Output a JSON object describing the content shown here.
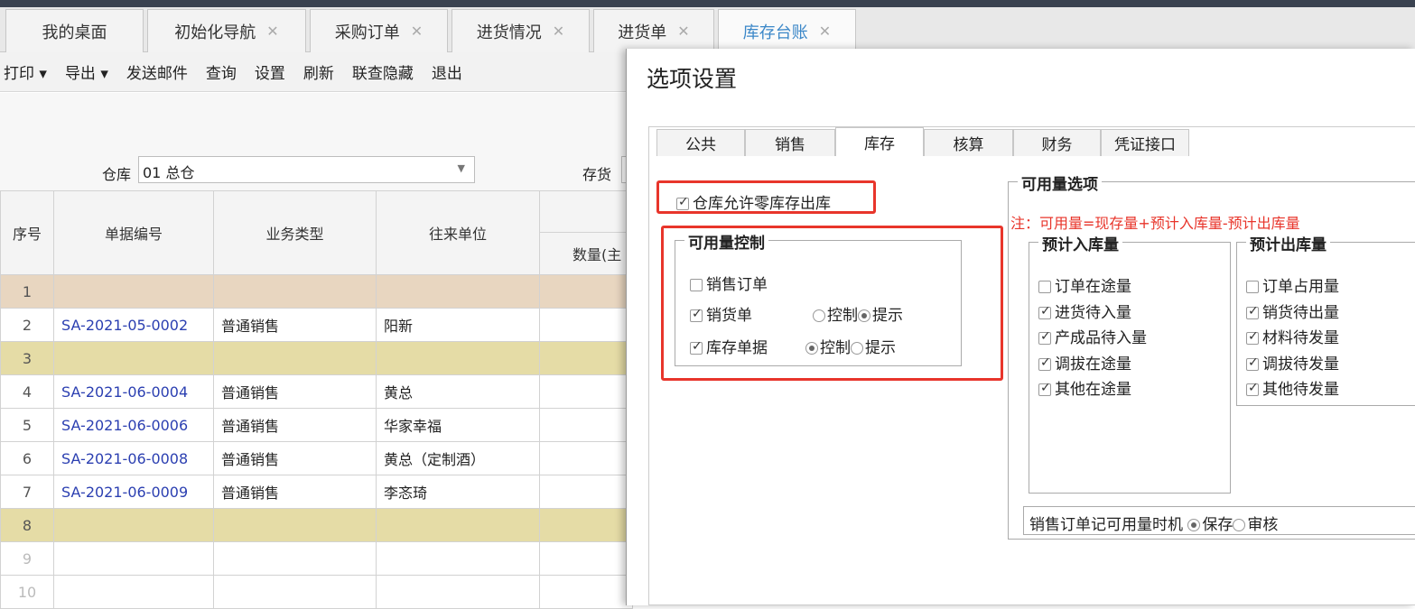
{
  "tabs": [
    {
      "label": "我的桌面",
      "closable": false
    },
    {
      "label": "初始化导航",
      "closable": true
    },
    {
      "label": "采购订单",
      "closable": true
    },
    {
      "label": "进货情况",
      "closable": true
    },
    {
      "label": "进货单",
      "closable": true
    },
    {
      "label": "库存台账",
      "closable": true,
      "active": true
    }
  ],
  "toolbar": {
    "print": "打印 ▾",
    "export": "导出 ▾",
    "email": "发送邮件",
    "query": "查询",
    "settings": "设置",
    "refresh": "刷新",
    "toggle": "联查隐藏",
    "exit": "退出"
  },
  "filter": {
    "warehouse_label": "仓库",
    "warehouse_value": "01 总仓",
    "inventory_label": "存货"
  },
  "grid": {
    "headers": {
      "seq": "序号",
      "doc_no": "单据编号",
      "biz_type": "业务类型",
      "partner": "往来单位",
      "qty": "数量(主"
    },
    "rows": [
      {
        "seq": "1",
        "doc_no": "",
        "biz_type": "",
        "partner": "",
        "style": "orange"
      },
      {
        "seq": "2",
        "doc_no": "SA-2021-05-0002",
        "biz_type": "普通销售",
        "partner": "阳新",
        "style": ""
      },
      {
        "seq": "3",
        "doc_no": "",
        "biz_type": "",
        "partner": "",
        "style": "yellow"
      },
      {
        "seq": "4",
        "doc_no": "SA-2021-06-0004",
        "biz_type": "普通销售",
        "partner": "黄总",
        "style": ""
      },
      {
        "seq": "5",
        "doc_no": "SA-2021-06-0006",
        "biz_type": "普通销售",
        "partner": "华家幸福",
        "style": ""
      },
      {
        "seq": "6",
        "doc_no": "SA-2021-06-0008",
        "biz_type": "普通销售",
        "partner": "黄总（定制酒）",
        "style": ""
      },
      {
        "seq": "7",
        "doc_no": "SA-2021-06-0009",
        "biz_type": "普通销售",
        "partner": "李忞琦",
        "style": ""
      },
      {
        "seq": "8",
        "doc_no": "",
        "biz_type": "",
        "partner": "",
        "style": "yellow"
      },
      {
        "seq": "9",
        "doc_no": "",
        "biz_type": "",
        "partner": "",
        "style": "grey"
      },
      {
        "seq": "10",
        "doc_no": "",
        "biz_type": "",
        "partner": "",
        "style": "grey"
      }
    ]
  },
  "dialog": {
    "title": "选项设置",
    "tabs": [
      "公共",
      "销售",
      "库存",
      "核算",
      "财务",
      "凭证接口"
    ],
    "active_tab": "库存",
    "allow_zero_stock": {
      "label": "仓库允许零库存出库",
      "checked": true
    },
    "avail_control": {
      "legend": "可用量控制",
      "sales_order": {
        "label": "销售订单",
        "checked": false
      },
      "sales_delivery": {
        "label": "销货单",
        "checked": true,
        "opt1": "控制",
        "opt2": "提示",
        "selected": "提示"
      },
      "stock_doc": {
        "label": "库存单据",
        "checked": true,
        "opt1": "控制",
        "opt2": "提示",
        "selected": "控制"
      }
    },
    "avail_options": {
      "legend": "可用量选项",
      "note": "注：可用量=现存量+预计入库量-预计出库量",
      "inbound": {
        "legend": "预计入库量",
        "items": [
          {
            "label": "订单在途量",
            "checked": false
          },
          {
            "label": "进货待入量",
            "checked": true
          },
          {
            "label": "产成品待入量",
            "checked": true
          },
          {
            "label": "调拔在途量",
            "checked": true
          },
          {
            "label": "其他在途量",
            "checked": true
          }
        ]
      },
      "outbound": {
        "legend": "预计出库量",
        "items": [
          {
            "label": "订单占用量",
            "checked": false
          },
          {
            "label": "销货待出量",
            "checked": true
          },
          {
            "label": "材料待发量",
            "checked": true
          },
          {
            "label": "调拔待发量",
            "checked": true
          },
          {
            "label": "其他待发量",
            "checked": true
          }
        ]
      },
      "timing": {
        "label": "销售订单记可用量时机",
        "opt1": "保存",
        "opt2": "审核",
        "selected": "保存"
      }
    }
  },
  "colors": {
    "highlight": "#e8352b",
    "link": "#2b3fb1",
    "active_tab": "#3b87c8",
    "note": "#e8352b"
  }
}
